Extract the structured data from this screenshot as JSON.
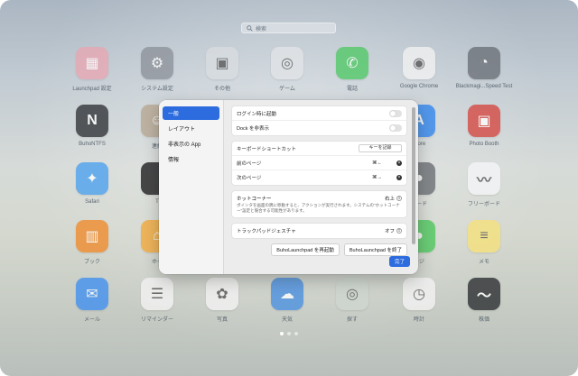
{
  "search": {
    "placeholder": "検索"
  },
  "apps": [
    {
      "label": "Launchpad 設定",
      "icon": "grid-icon",
      "bg": "#e8a7b2",
      "glyph": "▦"
    },
    {
      "label": "システム設定",
      "icon": "gear-icon",
      "bg": "#8d929a",
      "glyph": "⚙"
    },
    {
      "label": "その他",
      "icon": "folder-icon",
      "bg": "#d9dde1",
      "glyph": "▣"
    },
    {
      "label": "ゲーム",
      "icon": "folder-icon",
      "bg": "#e2e4e7",
      "glyph": "◎"
    },
    {
      "label": "電話",
      "icon": "phone-icon",
      "bg": "#4fc865",
      "glyph": "✆"
    },
    {
      "label": "Google Chrome",
      "icon": "chrome-icon",
      "bg": "#f2f2f2",
      "glyph": "◉"
    },
    {
      "label": "Blackmagi...Speed Test",
      "icon": "speedometer-icon",
      "bg": "#6a6f76",
      "glyph": "◔"
    },
    {
      "label": "BuhoNTFS",
      "icon": "ntfs-icon",
      "bg": "#2f3135",
      "glyph": "N"
    },
    {
      "label": "連絡",
      "icon": "contacts-icon",
      "bg": "#b8a893",
      "glyph": "☺"
    },
    {
      "label": "Store",
      "icon": "appstore-icon",
      "bg": "#2f86f0",
      "glyph": "A"
    },
    {
      "label": "Photo Booth",
      "icon": "photobooth-icon",
      "bg": "#d5463f",
      "glyph": "▣"
    },
    {
      "label": "Safari",
      "icon": "safari-icon",
      "bg": "#4aa0ef",
      "glyph": "✦"
    },
    {
      "label": "T",
      "icon": "apple-tv-icon",
      "bg": "#1c1c1e",
      "glyph": ""
    },
    {
      "label": "ワード",
      "icon": "passwords-icon",
      "bg": "#6b6f74",
      "glyph": "●"
    },
    {
      "label": "フリーボード",
      "icon": "freeform-icon",
      "bg": "#f4f6f8",
      "glyph": "〰"
    },
    {
      "label": "ブック",
      "icon": "books-icon",
      "bg": "#f08a2a",
      "glyph": "▥"
    },
    {
      "label": "ホー",
      "icon": "home-icon",
      "bg": "#f4a93a",
      "glyph": "⌂"
    },
    {
      "label": "ージ",
      "icon": "messages-icon",
      "bg": "#4cc85b",
      "glyph": "●"
    },
    {
      "label": "メモ",
      "icon": "notes-icon",
      "bg": "#f7e27a",
      "glyph": "≡"
    },
    {
      "label": "メール",
      "icon": "mail-icon",
      "bg": "#3f8ff0",
      "glyph": "✉"
    },
    {
      "label": "リマインダー",
      "icon": "reminders-icon",
      "bg": "#f4f4f4",
      "glyph": "☰"
    },
    {
      "label": "写真",
      "icon": "photos-icon",
      "bg": "#f4f4f4",
      "glyph": "✿"
    },
    {
      "label": "天気",
      "icon": "weather-icon",
      "bg": "#4a90e2",
      "glyph": "☁"
    },
    {
      "label": "探す",
      "icon": "findmy-icon",
      "bg": "#cfd7d0",
      "glyph": "◎"
    },
    {
      "label": "時計",
      "icon": "clock-icon",
      "bg": "#f4f4f4",
      "glyph": "◷"
    },
    {
      "label": "株価",
      "icon": "stocks-icon",
      "bg": "#2a2c30",
      "glyph": "〜"
    }
  ],
  "dialog": {
    "sidebar": [
      {
        "label": "一般",
        "active": true
      },
      {
        "label": "レイアウト",
        "active": false
      },
      {
        "label": "非表示の App",
        "active": false
      },
      {
        "label": "情報",
        "active": false
      }
    ],
    "login_label": "ログイン時に起動",
    "dock_label": "Dock を非表示",
    "kb_label": "キーボードショートカット",
    "kb_button": "キーを記録",
    "prev_label": "前のページ",
    "prev_keys": "⌘←",
    "next_label": "次のページ",
    "next_keys": "⌘→",
    "hot_label": "ホットコーナー",
    "hot_value": "右上",
    "hot_desc": "ポインタを画面の隅に移動すると、アクションが実行されます。システムの\"ホットコーナー\"設定と競合する可能性があります。",
    "trackpad_label": "トラックパッドジェスチャ",
    "trackpad_value": "オフ",
    "restart_btn": "BuhoLaunchpad を再起動",
    "quit_btn": "BuhoLaunchpad を終了",
    "done_btn": "完了"
  }
}
